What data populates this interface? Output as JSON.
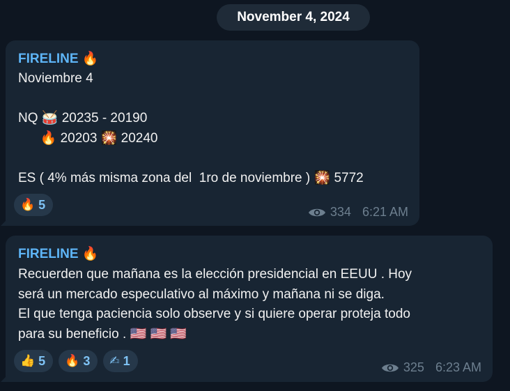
{
  "date_separator": "November 4, 2024",
  "messages": [
    {
      "author": "FIRELINE 🔥",
      "text": "Noviembre 4\n\nNQ 🥁 20235 - 20190\n      🔥 20203 🎇 20240\n\nES ( 4% más misma zona del  1ro de noviembre ) 🎇 5772",
      "reactions": [
        {
          "emoji": "🔥",
          "count": "5"
        }
      ],
      "views": "334",
      "time": "6:21 AM"
    },
    {
      "author": "FIRELINE 🔥",
      "text": "Recuerden que mañana es la elección presidencial en EEUU . Hoy\nserá un mercado especulativo al máximo y mañana ni se diga.\nEl que tenga paciencia solo observe y si quiere operar proteja todo\npara su beneficio . 🇺🇸 🇺🇸 🇺🇸",
      "reactions": [
        {
          "emoji": "👍",
          "count": "5"
        },
        {
          "emoji": "🔥",
          "count": "3"
        },
        {
          "emoji": "✍",
          "count": "1"
        }
      ],
      "views": "325",
      "time": "6:23 AM"
    }
  ],
  "icons": {
    "views": "eye-icon"
  },
  "colors": {
    "background": "#0e1621",
    "bubble": "#182533",
    "author": "#5eb5f7",
    "reaction_bg": "#26384a",
    "reaction_text": "#7fc3f5",
    "meta": "#6d7f8f"
  }
}
